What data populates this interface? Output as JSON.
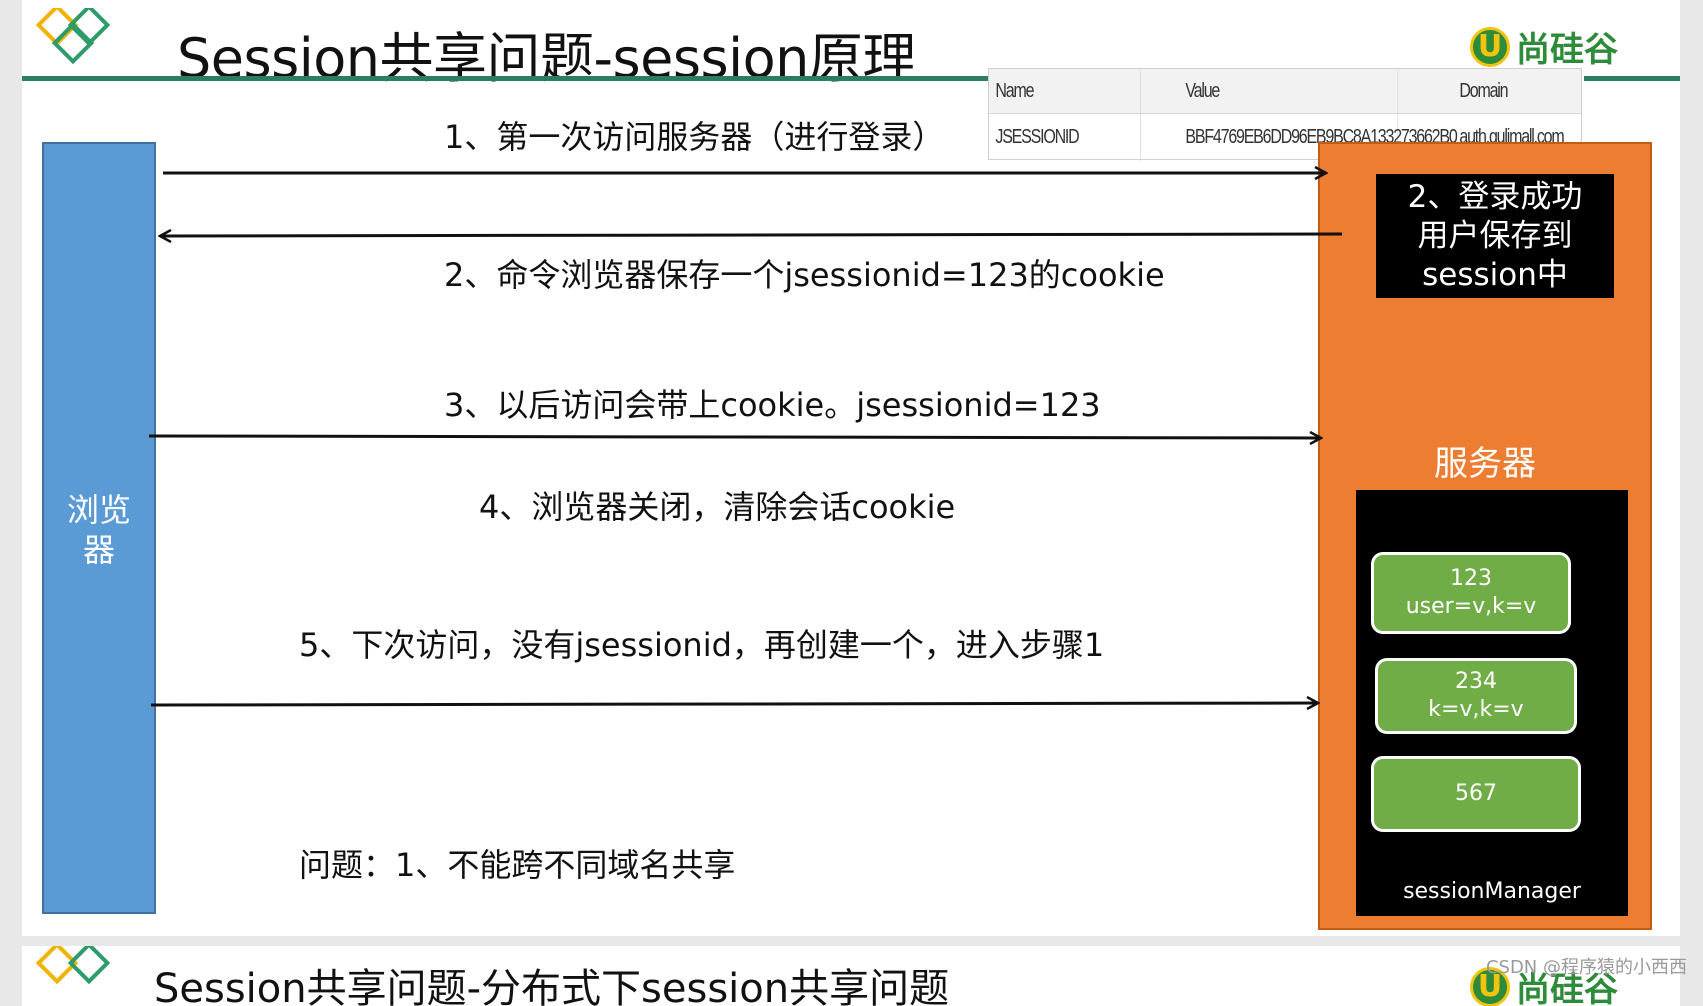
{
  "slide": {
    "title": "Session共享问题-session原理",
    "brand": "尚硅谷",
    "brand_mark": "U"
  },
  "cookie_table": {
    "headers": [
      "Name",
      "Value",
      "Domain"
    ],
    "row": [
      "JSESSIONID",
      "BBF4769EB6DD96EB9BC8A133273662B0",
      "auth.gulimall.com"
    ]
  },
  "browser": {
    "label": "浏览器"
  },
  "server": {
    "label": "服务器",
    "login_note": [
      "2、登录成功",
      "用户保存到",
      "session中"
    ],
    "manager_label": "sessionManager",
    "sessions": [
      {
        "id": "123",
        "attrs": "user=v,k=v"
      },
      {
        "id": "234",
        "attrs": "k=v,k=v"
      },
      {
        "id": "567",
        "attrs": ""
      }
    ]
  },
  "messages": {
    "step1": "1、第一次访问服务器（进行登录）",
    "step2": "2、命令浏览器保存一个jsessionid=123的cookie",
    "step3": "3、以后访问会带上cookie。jsessionid=123",
    "step4": "4、浏览器关闭，清除会话cookie",
    "step5": "5、下次访问，没有jsessionid，再创建一个，进入步骤1",
    "problem": "问题：1、不能跨不同域名共享"
  },
  "next_slide": {
    "title": "Session共享问题-分布式下session共享问题",
    "brand": "尚硅谷",
    "brand_mark": "U"
  },
  "watermark": "CSDN @程序猿的小西西",
  "colors": {
    "browser": "#5b9bd5",
    "server": "#ed7d31",
    "session": "#70ad47",
    "rule": "#2e7d5e"
  }
}
